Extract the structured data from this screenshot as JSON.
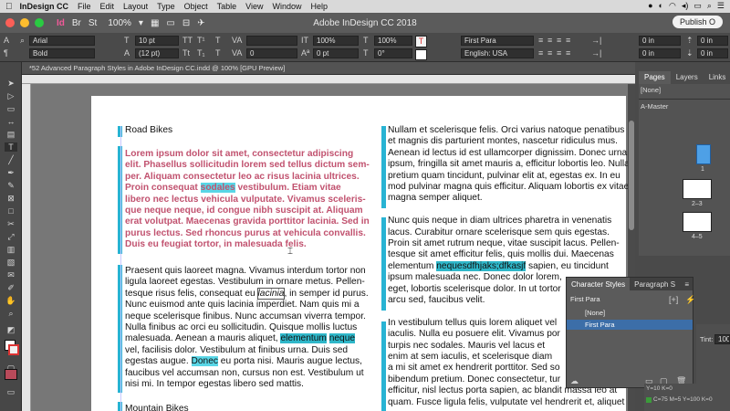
{
  "menubar": {
    "app": "InDesign CC",
    "items": [
      "File",
      "Edit",
      "Layout",
      "Type",
      "Object",
      "Table",
      "View",
      "Window",
      "Help"
    ]
  },
  "titlebar": {
    "zoom": "100%",
    "title": "Adobe InDesign CC 2018",
    "publish": "Publish O"
  },
  "control": {
    "font_family": "Arial",
    "font_style": "Bold",
    "font_size": "10 pt",
    "leading": "(12 pt)",
    "tracking": "0",
    "hscale": "100%",
    "vscale": "100%",
    "baseline": "0 pt",
    "skew": "0°",
    "para_style": "First Para",
    "language": "English: USA",
    "indent_a": "0 in",
    "indent_b": "0 in",
    "space_a": "0 in",
    "space_b": "0 in"
  },
  "doctab": {
    "title": "*52 Advanced Paragraph Styles in Adobe InDesign CC.indd @ 100% [GPU Preview]"
  },
  "left_col": {
    "heading1": "Road Bikes",
    "pink_lines": [
      "Lorem ipsum dolor sit amet, consectetur adipiscing",
      "elit. Phasellus sollicitudin lorem sed tellus dictum sem-",
      "per. Aliquam consectetur leo ac risus lacinia ultrices.",
      "Proin consequat |sodales| vestibulum. Etiam vitae",
      "libero nec lectus vehicula vulputate. Vivamus sceleris-",
      "que neque neque, id congue nibh suscipit at. Aliquam",
      "erat volutpat. Maecenas gravida porttitor lacinia. Sed in",
      "purus lectus. Sed rhoncus purus at vehicula convallis.",
      "Duis eu feugiat tortor, in malesuada felis."
    ],
    "body_lines": [
      "Praesent quis laoreet magna. Vivamus interdum tortor non",
      "ligula laoreet egestas. Vestibulum in ornare metus. Pellen-",
      "tesque risus felis, consequat eu lacinia, in semper id purus.",
      "Nunc euismod ante quis lacinia imperdiet. Nam quis mi a",
      "neque scelerisque finibus. Nunc accumsan viverra tempor.",
      "Nulla finibus ac orci eu sollicitudin. Quisque mollis luctus",
      "malesuada. Aenean a mauris aliquet, elementum neque",
      "vel, facilisis dolor. Vestibulum at finibus urna. Duis sed",
      "egestas augue. Donec eu porta nisi. Mauris augue lectus,",
      "faucibus vel accumsan non, cursus non est. Vestibulum ut",
      "nisi mi. In tempor egestas libero sed mattis."
    ],
    "heading2": "Mountain Bikes"
  },
  "right_col": {
    "lines": [
      "Nullam et scelerisque felis. Orci varius natoque penatibus",
      "et magnis dis parturient montes, nascetur ridiculus mus.",
      "Aenean id lectus id est ullamcorper dignissim. Donec urna",
      "ipsum, fringilla sit amet mauris a, efficitur lobortis leo. Nulla",
      "pretium quam tincidunt, pulvinar elit at, egestas ex. In eu",
      "mod pulvinar magna quis efficitur. Aliquam lobortis ex vitae",
      "magna semper aliquet.",
      "",
      "Nunc quis neque in diam ultrices pharetra in venenatis",
      "lacus. Curabitur ornare scelerisque sem quis egestas.",
      "Proin sit amet rutrum neque, vitae suscipit lacus. Pellen-",
      "tesque sit amet efficitur felis, quis mollis dui. Maecenas",
      "elementum |nequesdfhjaks;dfkasjf| sapien, eu tincidunt",
      "ipsum malesuada nec. Donec dolor lorem,",
      "eget, lobortis scelerisque dolor. In ut tortor",
      "arcu sed, faucibus velit.",
      "",
      "In vestibulum tellus quis lorem aliquet vel",
      "iaculis. Nulla eu posuere elit. Vivamus por",
      "turpis nec sodales. Mauris vel lacus et",
      "enim at sem iaculis, et scelerisque diam",
      "a mi sit amet ex hendrerit porttitor. Sed so",
      "bibendum pretium. Donec consectetur, tur",
      "efficitur, nisl lectus porta sapien, ac blandit massa leo at",
      "quam. Fusce ligula felis, vulputate vel hendrerit et, aliquet"
    ]
  },
  "pages_panel": {
    "tabs": [
      "Pages",
      "Layers",
      "Links"
    ],
    "none": "[None]",
    "master": "A-Master",
    "page1": "1",
    "spread23": "2–3",
    "spread45": "4–5"
  },
  "char_styles": {
    "tabs": [
      "Character Styles",
      "Paragraph S"
    ],
    "current": "First Para",
    "items": [
      "[None]",
      "First Para"
    ]
  },
  "swatches": {
    "tint_label": "Tint:",
    "tint_value": "100",
    "y10": "Y=10 K=0",
    "c75": "C=75 M=5 Y=100 K=0"
  },
  "colors": {
    "accent": "#28b3d3",
    "highlight": "#59d6e6",
    "pink": "#c1526f"
  }
}
